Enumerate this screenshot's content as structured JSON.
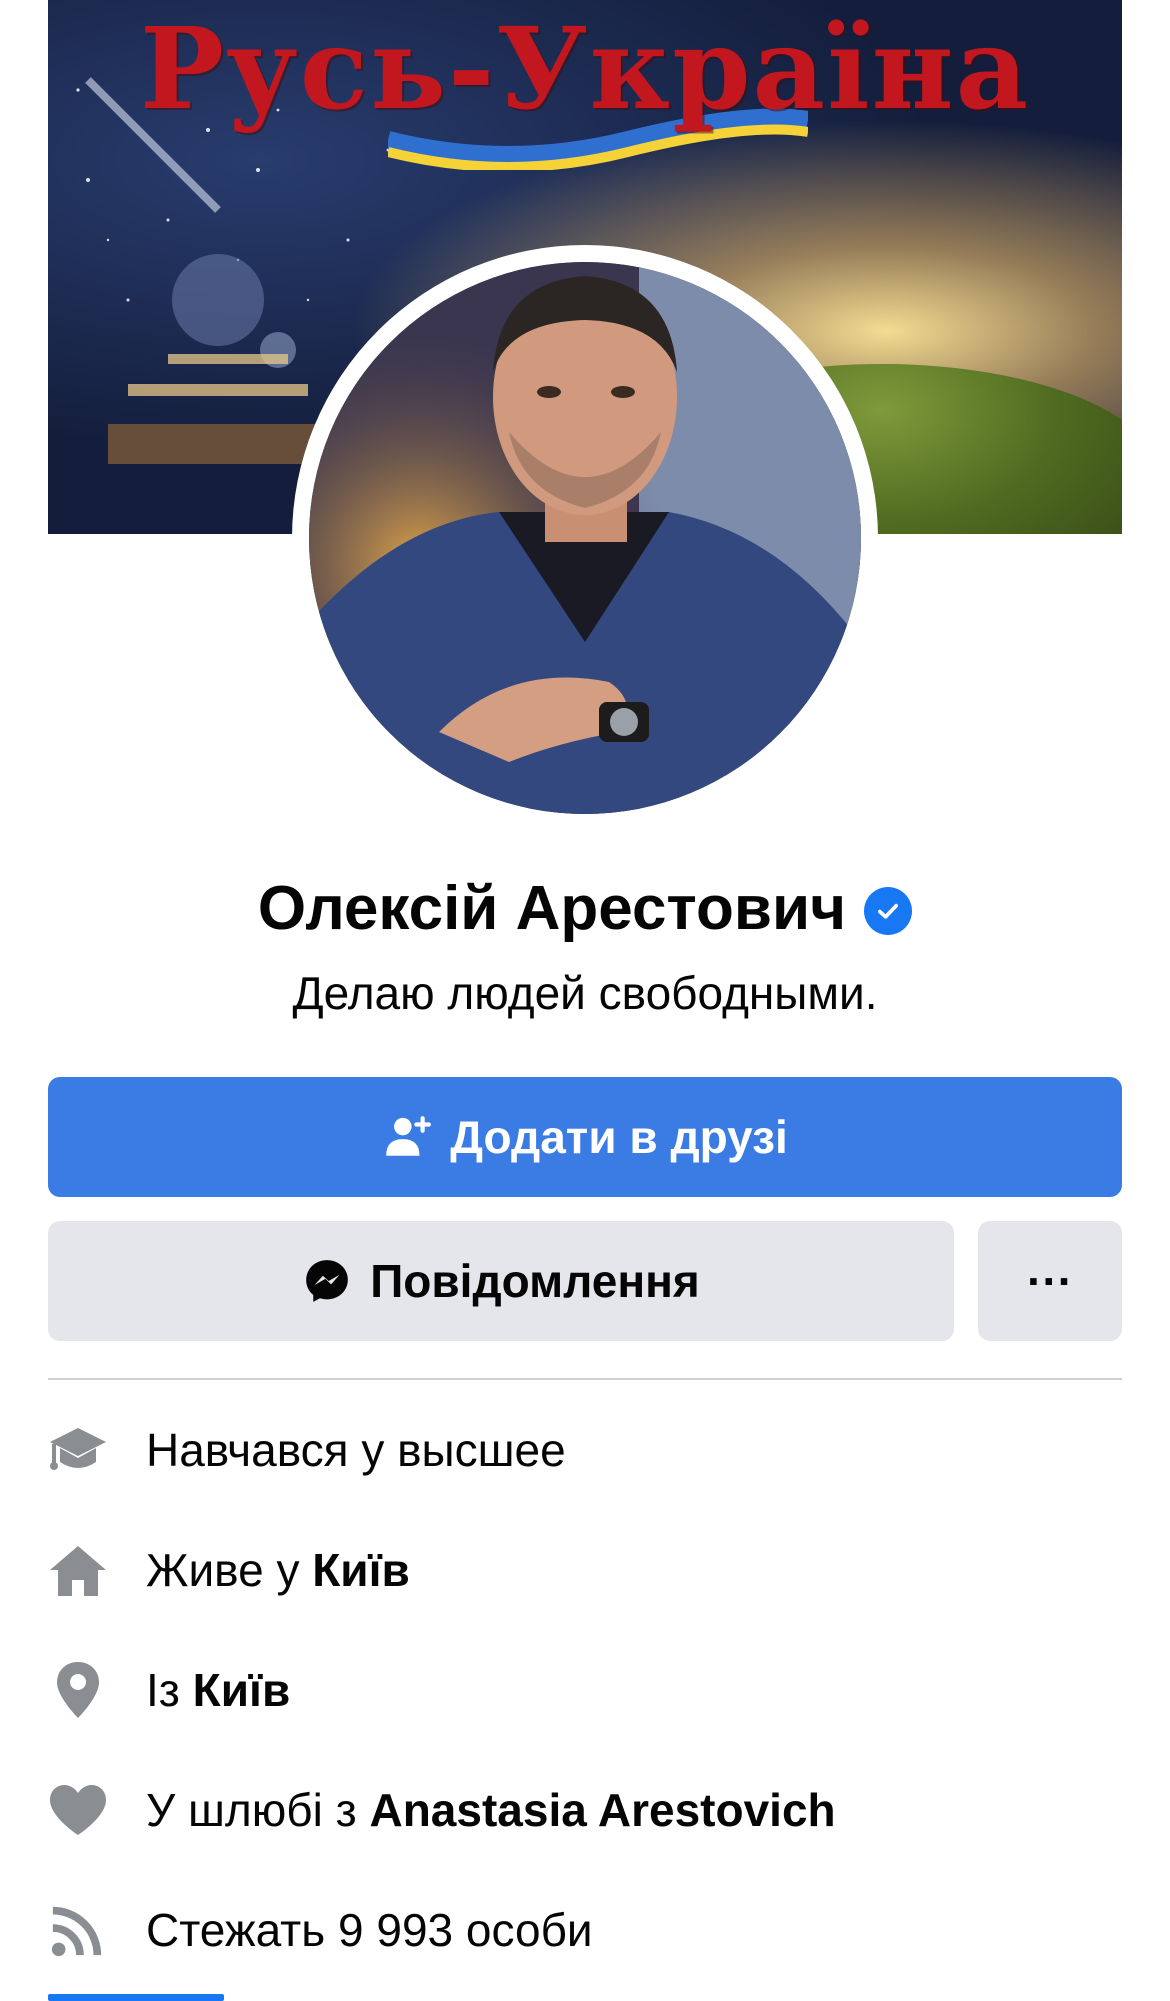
{
  "cover": {
    "title": "Русь-Україна"
  },
  "profile": {
    "name": "Олексій Арестович",
    "bio": "Делаю людей свободными."
  },
  "actions": {
    "add_friend_label": "Додати в друзі",
    "message_label": "Повідомлення",
    "more_label": "···"
  },
  "info": {
    "education_text": "Навчався у высшее",
    "lives_prefix": "Живе у ",
    "lives_city": "Київ",
    "from_prefix": "Із ",
    "from_city": "Київ",
    "relationship_prefix": "У шлюбі з ",
    "relationship_partner": "Anastasia Arestovich",
    "followers_text": "Стежать 9 993 особи"
  },
  "colors": {
    "primary": "#3b7be4",
    "secondary_button": "#e4e6eb",
    "verified": "#1877f2",
    "icon_gray": "#8a8d91"
  },
  "icons": {
    "add_friend": "person-plus-icon",
    "messenger": "messenger-icon",
    "more": "more-dots-icon",
    "education": "graduation-cap-icon",
    "home": "home-icon",
    "location": "location-pin-icon",
    "relationship": "heart-icon",
    "followers": "rss-icon",
    "verified": "verified-badge-icon"
  }
}
